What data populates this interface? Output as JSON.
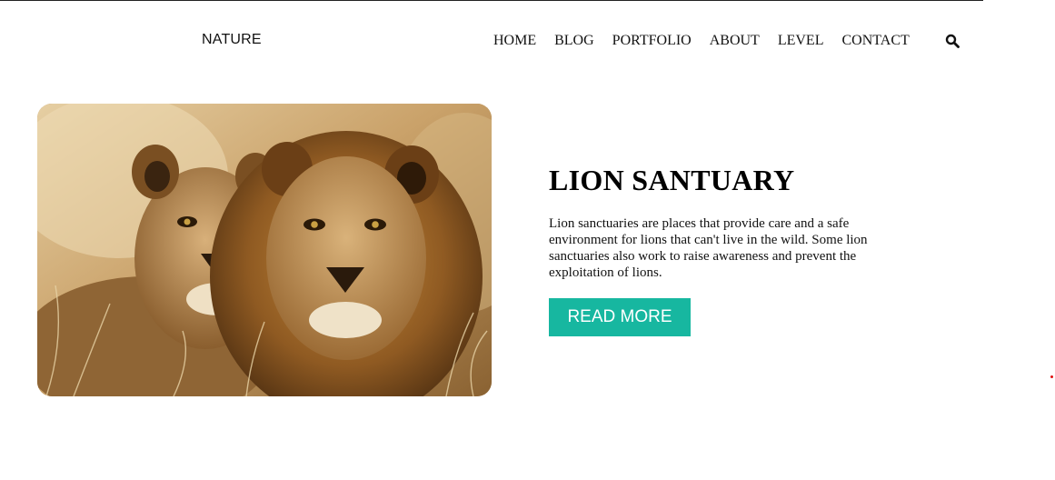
{
  "header": {
    "brand": "NATURE",
    "nav": [
      {
        "label": "HOME"
      },
      {
        "label": "BLOG"
      },
      {
        "label": "PORTFOLIO"
      },
      {
        "label": "ABOUT"
      },
      {
        "label": "LEVEL"
      },
      {
        "label": "CONTACT"
      }
    ],
    "search_icon": "search-icon"
  },
  "hero": {
    "image_subject": "two lions lying in dry grass",
    "title": "LION SANTUARY",
    "description": "Lion sanctuaries are places that provide care and a safe environment for lions that can't live in the wild. Some lion sanctuaries also work to raise awareness and prevent the exploitation of lions.",
    "button_label": "READ MORE"
  },
  "colors": {
    "accent": "#17b7a0",
    "text": "#111111",
    "background": "#ffffff",
    "marker": "#e01010"
  }
}
